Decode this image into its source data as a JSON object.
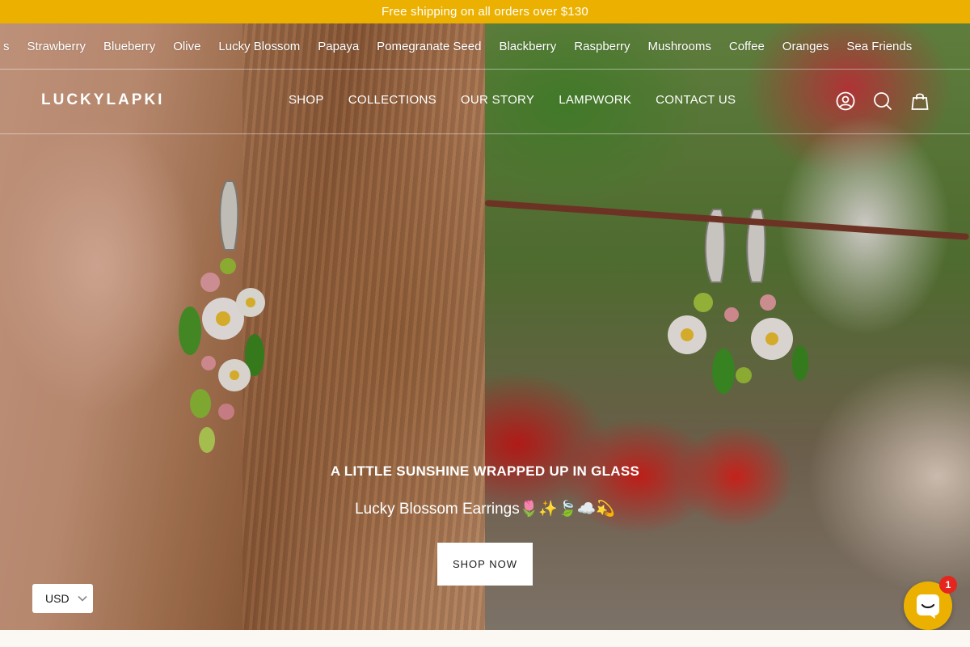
{
  "announcement": "Free shipping on all orders over $130",
  "top_links": [
    "s",
    "Strawberry",
    "Blueberry",
    "Olive",
    "Lucky Blossom",
    "Papaya",
    "Pomegranate Seed",
    "Blackberry",
    "Raspberry",
    "Mushrooms",
    "Coffee",
    "Oranges",
    "Sea Friends"
  ],
  "header": {
    "logo": "LUCKYLAPKI",
    "nav": [
      "SHOP",
      "COLLECTIONS",
      "OUR STORY",
      "LAMPWORK",
      "CONTACT US"
    ],
    "icons": [
      "account-icon",
      "search-icon",
      "cart-icon"
    ]
  },
  "hero": {
    "kicker": "A LITTLE SUNSHINE WRAPPED UP IN GLASS",
    "title": "Lucky Blossom Earrings🌷✨🍃☁️💫",
    "cta": "SHOP NOW"
  },
  "currency": {
    "value": "USD"
  },
  "chat": {
    "badge": "1"
  },
  "colors": {
    "accent": "#ecb100",
    "badge": "#e5261e"
  }
}
